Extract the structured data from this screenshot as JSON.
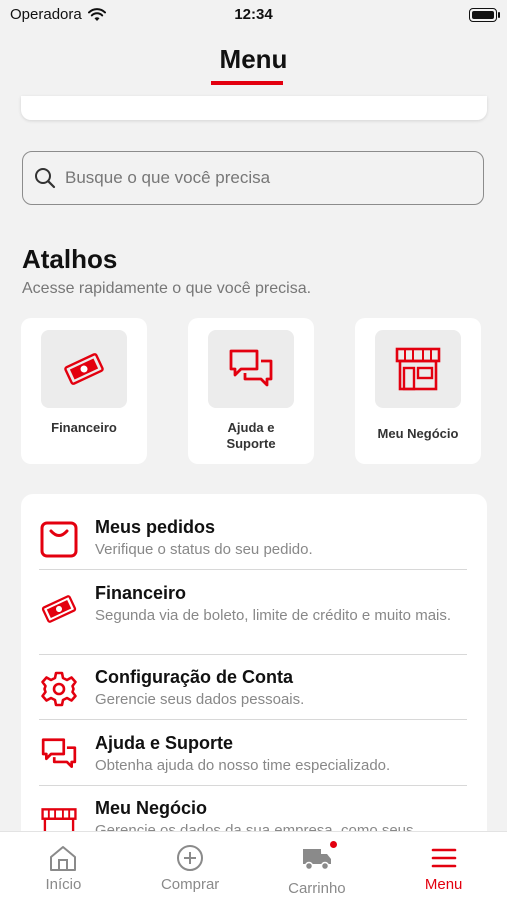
{
  "status_bar": {
    "carrier": "Operadora",
    "time": "12:34"
  },
  "header": {
    "title": "Menu"
  },
  "search": {
    "placeholder": "Busque o que você precisa"
  },
  "shortcuts_section": {
    "title": "Atalhos",
    "subtitle": "Acesse rapidamente o que você precisa.",
    "items": [
      {
        "label": "Financeiro",
        "icon": "money-icon"
      },
      {
        "label": "Ajuda e Suporte",
        "icon": "chat-icon"
      },
      {
        "label": "Meu Negócio",
        "icon": "store-icon"
      }
    ]
  },
  "menu_items": [
    {
      "title": "Meus pedidos",
      "description": "Verifique o status do seu pedido.",
      "icon": "bag-icon"
    },
    {
      "title": "Financeiro",
      "description": "Segunda via de boleto, limite de crédito e muito mais.",
      "icon": "money-icon"
    },
    {
      "title": "Configuração de Conta",
      "description": "Gerencie seus dados pessoais.",
      "icon": "gear-icon"
    },
    {
      "title": "Ajuda e Suporte",
      "description": "Obtenha ajuda do nosso time especializado.",
      "icon": "chat-icon"
    },
    {
      "title": "Meu Negócio",
      "description": "Gerencie os dados da sua empresa, como seus",
      "icon": "store-icon"
    }
  ],
  "tab_bar": {
    "tabs": [
      {
        "label": "Início",
        "icon": "home-icon"
      },
      {
        "label": "Comprar",
        "icon": "plus-circle-icon"
      },
      {
        "label": "Carrinho",
        "icon": "truck-icon"
      },
      {
        "label": "Menu",
        "icon": "hamburger-icon"
      }
    ],
    "active": "Menu"
  },
  "colors": {
    "accent": "#e3000f",
    "background": "#f2f2f2",
    "card": "#ffffff",
    "muted_text": "#888888"
  }
}
